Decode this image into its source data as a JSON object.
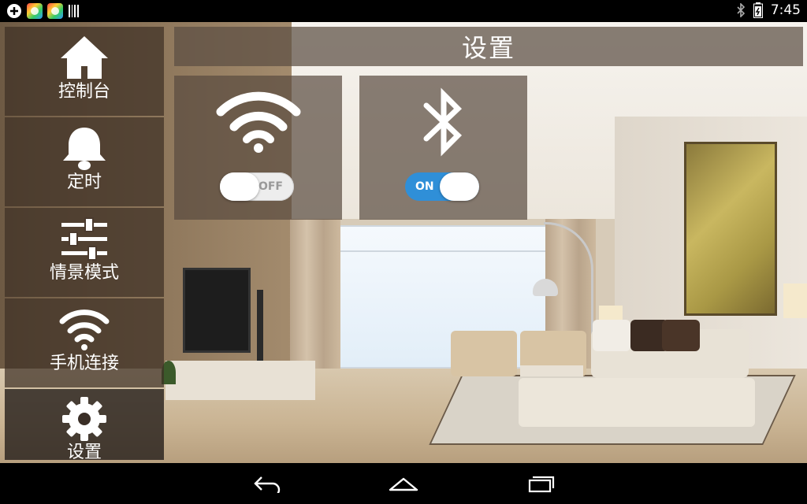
{
  "status_bar": {
    "time": "7:45",
    "left_icons": [
      "sync-icon",
      "app-icon",
      "app-icon",
      "barcode-icon"
    ],
    "right_icons": [
      "bluetooth-icon",
      "battery-icon"
    ]
  },
  "sidebar": {
    "items": [
      {
        "label": "控制台",
        "icon": "home-icon"
      },
      {
        "label": "定时",
        "icon": "bell-icon"
      },
      {
        "label": "情景模式",
        "icon": "sliders-icon"
      },
      {
        "label": "手机连接",
        "icon": "wifi-icon"
      },
      {
        "label": "设置",
        "icon": "gear-icon"
      }
    ]
  },
  "header": {
    "title": "设置"
  },
  "tiles": {
    "wifi": {
      "icon": "wifi-icon",
      "toggle_label": "OFF",
      "state": "off"
    },
    "bluetooth": {
      "icon": "bluetooth-icon",
      "toggle_label": "ON",
      "state": "on",
      "accent": "#2f8fd8"
    }
  },
  "nav_bar": {
    "buttons": [
      "back-icon",
      "home-outline-icon",
      "recent-apps-icon"
    ]
  }
}
